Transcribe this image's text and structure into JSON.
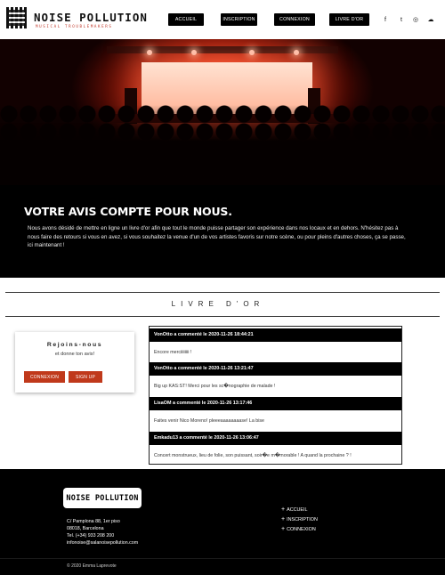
{
  "header": {
    "logo_title": "NOISE POLLUTION",
    "logo_subtitle": "MUSICAL TROUBLEMAKERS",
    "nav": [
      {
        "label": "ACCUEIL"
      },
      {
        "label": "INSCRIPTION"
      },
      {
        "label": "CONNEXION"
      },
      {
        "label": "LIVRE D'OR"
      }
    ],
    "social": [
      {
        "icon": "facebook-icon",
        "glyph": "f"
      },
      {
        "icon": "twitter-icon",
        "glyph": "t"
      },
      {
        "icon": "instagram-icon",
        "glyph": "◎"
      },
      {
        "icon": "soundcloud-icon",
        "glyph": "☁"
      }
    ]
  },
  "intro": {
    "title": "VOTRE AVIS COMPTE POUR NOUS.",
    "text": "Nous avons désidé de mettre en ligne un livre d'or afin que tout le monde puisse partager son expérience dans nos locaux et en dehors. N'hésitez pas à nous faire des retours si vous en avez, si vous souhaitez la venue d'un de vos artistes favoris sur notre scène, ou pour pleins d'autres choses, ça se passe, ici maintenant !"
  },
  "guestbook": {
    "title": "LIVRE D'OR"
  },
  "join": {
    "title": "Rejoins-nous",
    "subtitle": "et donne ton avis!",
    "login_label": "CONNEXION",
    "signup_label": "SIGN UP"
  },
  "comments": [
    {
      "header": "VonOtto a commenté le 2020-11-26 18:44:21",
      "text": "Encore merciiiiiiii !"
    },
    {
      "header": "VonOtto a commenté le 2020-11-26 13:21:47",
      "text": "Big up KAS:ST! Merci pour les sc�nographie de malade !"
    },
    {
      "header": "LisaOM a commenté le 2020-11-26 13:17:46",
      "text": "Faites venir Nico Moreno! pleeeaaaaaaaase! La bise"
    },
    {
      "header": "Emkadu13 a commenté le 2020-11-26 13:06:47",
      "text": "Concert monstrueux, lieu de folie, son puissant, soir�e m�morable ! A quand la prochaine ? !"
    }
  ],
  "footer": {
    "logo": "NOISE POLLUTION",
    "address": [
      "C/ Pamplona 88, 1er piso",
      "08018, Barcelona",
      "Tel. (+34) 933 208 200",
      "infonoise@salanoisepollution.com"
    ],
    "links": [
      {
        "label": "ACCUEIL"
      },
      {
        "label": "INSCRIPTION"
      },
      {
        "label": "CONNEXION"
      }
    ],
    "copyright": "© 2020 Emma Laprevote"
  },
  "colors": {
    "accent": "#c0391b",
    "dark": "#000000"
  }
}
